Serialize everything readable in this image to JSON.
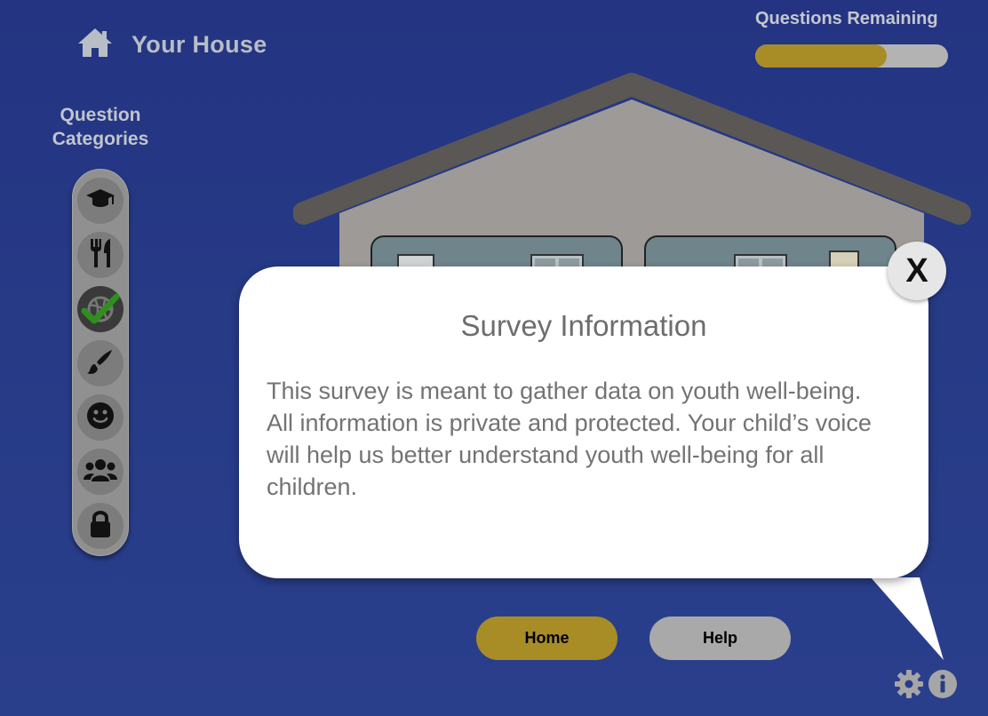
{
  "header": {
    "home_label": "Your House",
    "questions_remaining_label": "Questions Remaining",
    "progress_fraction": 0.68
  },
  "categories": {
    "title": "Question Categories",
    "items": [
      {
        "icon": "graduation-cap-icon",
        "active": false
      },
      {
        "icon": "fork-knife-icon",
        "active": false
      },
      {
        "icon": "sports-ball-icon",
        "active": true,
        "completed": true
      },
      {
        "icon": "paintbrush-icon",
        "active": false
      },
      {
        "icon": "smiley-face-icon",
        "active": false
      },
      {
        "icon": "people-group-icon",
        "active": false
      },
      {
        "icon": "lock-icon",
        "active": false
      }
    ]
  },
  "popup": {
    "title": "Survey Information",
    "body": "This survey is meant to gather data on youth well-being. All information is private and protected. Your child’s voice will help us better understand youth well-being for all children.",
    "close_label": "X"
  },
  "buttons": {
    "home": "Home",
    "help": "Help"
  },
  "corner_icons": [
    "gear-icon",
    "info-icon"
  ],
  "colors": {
    "background": "#263a86",
    "accent": "#a88d27",
    "secondary_button": "#a9a9a9",
    "completed_check": "#2f8f1e"
  }
}
